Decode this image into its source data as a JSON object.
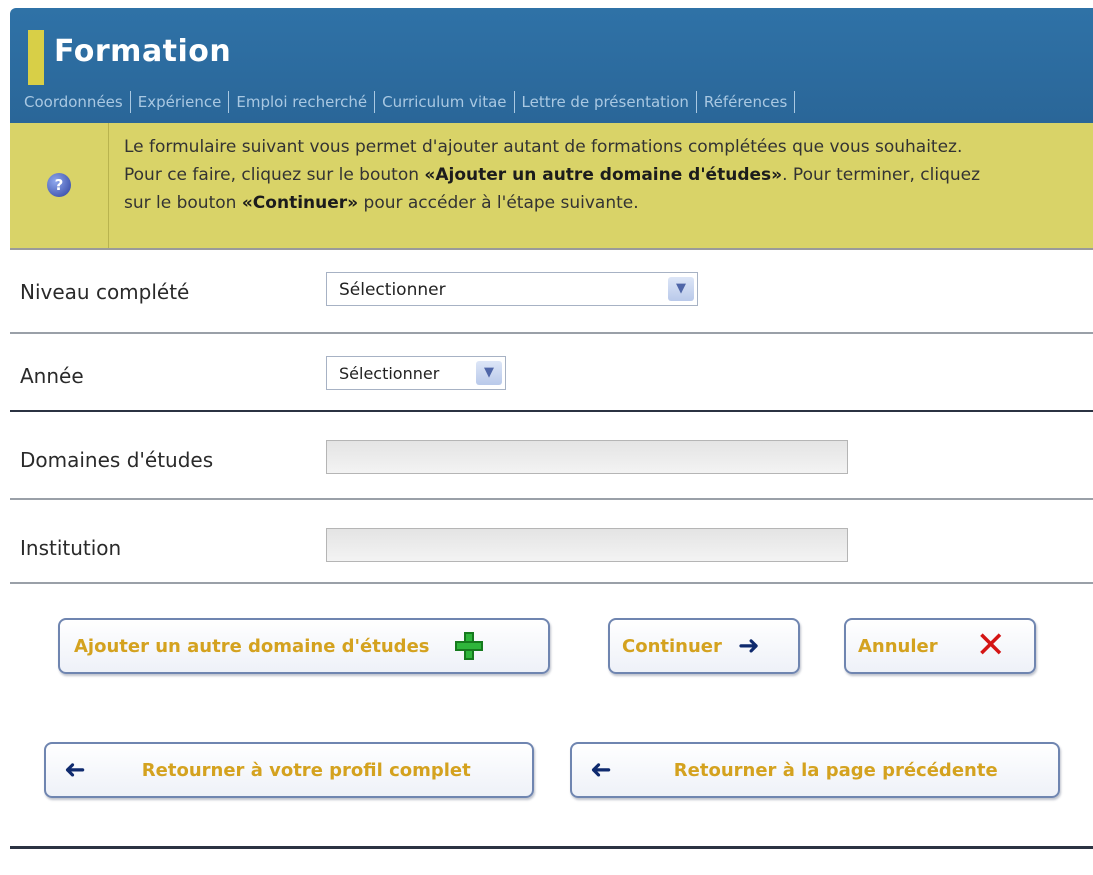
{
  "header": {
    "title": "Formation",
    "tabs": [
      "Coordonnées",
      "Expérience",
      "Emploi recherché",
      "Curriculum vitae",
      "Lettre de présentation",
      "Références"
    ]
  },
  "info": {
    "icon": "help-icon",
    "line1": "Le formulaire suivant vous permet d'ajouter autant de formations complétées que vous souhaitez.",
    "line2_prefix": "Pour ce faire, cliquez sur le bouton ",
    "line2_bold": "«Ajouter un autre domaine d'études»",
    "line2_suffix": ". Pour terminer, cliquez",
    "line3_prefix": "sur le bouton ",
    "line3_bold": "«Continuer»",
    "line3_suffix": " pour accéder à l'étape suivante."
  },
  "form": {
    "niveau": {
      "label": "Niveau complété",
      "selected": "Sélectionner"
    },
    "annee": {
      "label": "Année",
      "selected": "Sélectionner"
    },
    "domaines": {
      "label": "Domaines d'études",
      "value": ""
    },
    "institution": {
      "label": "Institution",
      "value": ""
    }
  },
  "buttons": {
    "add_domain": "Ajouter un autre domaine d'études",
    "continue": "Continuer",
    "cancel": "Annuler",
    "back_profile": "Retourner à votre profil complet",
    "back_previous": "Retourner à la page précédente"
  },
  "colors": {
    "header_blue": "#2f72a7",
    "accent_yellow": "#d8cf47",
    "info_bg": "#d9d368",
    "button_text": "#d4a21f",
    "plus_green": "#2fb53b",
    "cancel_red": "#d41515"
  }
}
